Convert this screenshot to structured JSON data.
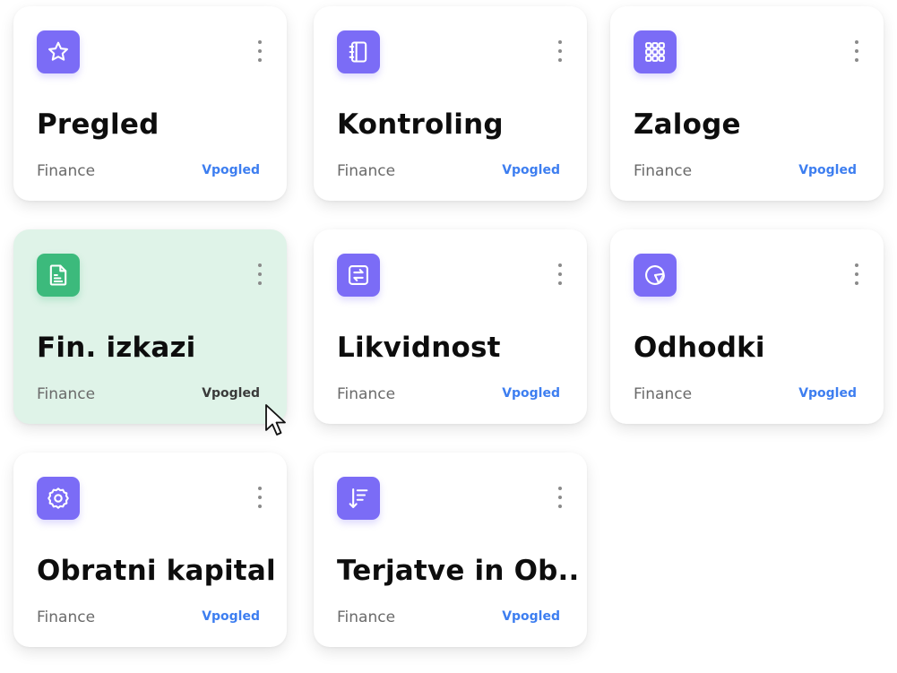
{
  "cards": [
    {
      "title": "Pregled",
      "category": "Finance",
      "action": "Vpogled",
      "icon": "star-icon"
    },
    {
      "title": "Kontroling",
      "category": "Finance",
      "action": "Vpogled",
      "icon": "notebook-icon"
    },
    {
      "title": "Zaloge",
      "category": "Finance",
      "action": "Vpogled",
      "icon": "grid-icon"
    },
    {
      "title": "Fin. izkazi",
      "category": "Finance",
      "action": "Vpogled",
      "icon": "document-icon",
      "active": true
    },
    {
      "title": "Likvidnost",
      "category": "Finance",
      "action": "Vpogled",
      "icon": "transfer-icon"
    },
    {
      "title": "Odhodki",
      "category": "Finance",
      "action": "Vpogled",
      "icon": "pie-chart-icon"
    },
    {
      "title": "Obratni kapital",
      "category": "Finance",
      "action": "Vpogled",
      "icon": "gear-icon"
    },
    {
      "title": "Terjatve in Ob..",
      "category": "Finance",
      "action": "Vpogled",
      "icon": "sort-descending-icon"
    }
  ],
  "colors": {
    "accent": "#7b6cf6",
    "active_accent": "#3cba7c",
    "active_background": "#dff3e8",
    "link": "#3d7ef0"
  }
}
